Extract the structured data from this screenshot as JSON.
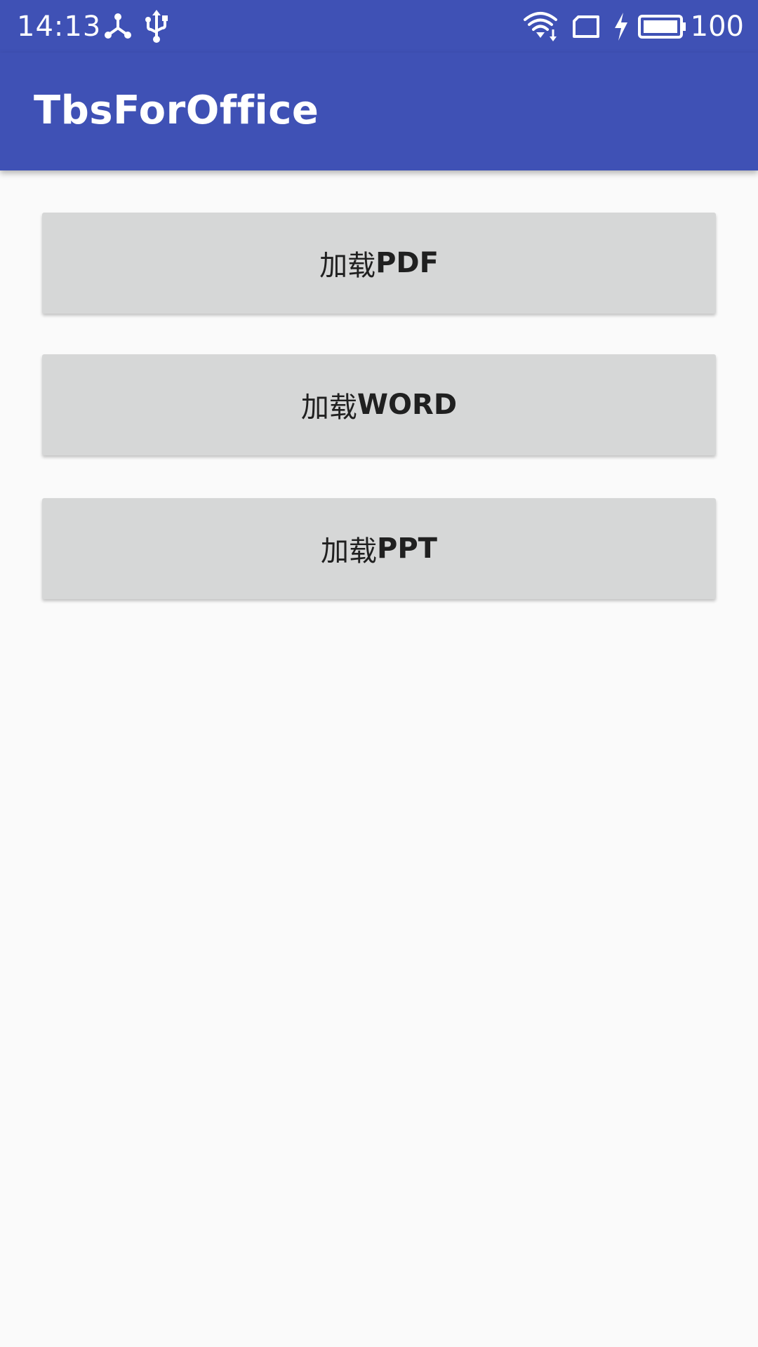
{
  "status_bar": {
    "time": "14:13",
    "battery_level": "100",
    "icons": [
      "share-icon",
      "usb-icon",
      "wifi-icon",
      "sim-card-icon",
      "charging-icon",
      "battery-icon"
    ]
  },
  "app_bar": {
    "title": "TbsForOffice"
  },
  "buttons": [
    {
      "prefix": "加载",
      "suffix": "PDF"
    },
    {
      "prefix": "加载",
      "suffix": "WORD"
    },
    {
      "prefix": "加载",
      "suffix": "PPT"
    }
  ],
  "colors": {
    "primary": "#3f51b5",
    "background": "#fafafa",
    "button": "#d6d7d7",
    "button_text": "#202020"
  }
}
